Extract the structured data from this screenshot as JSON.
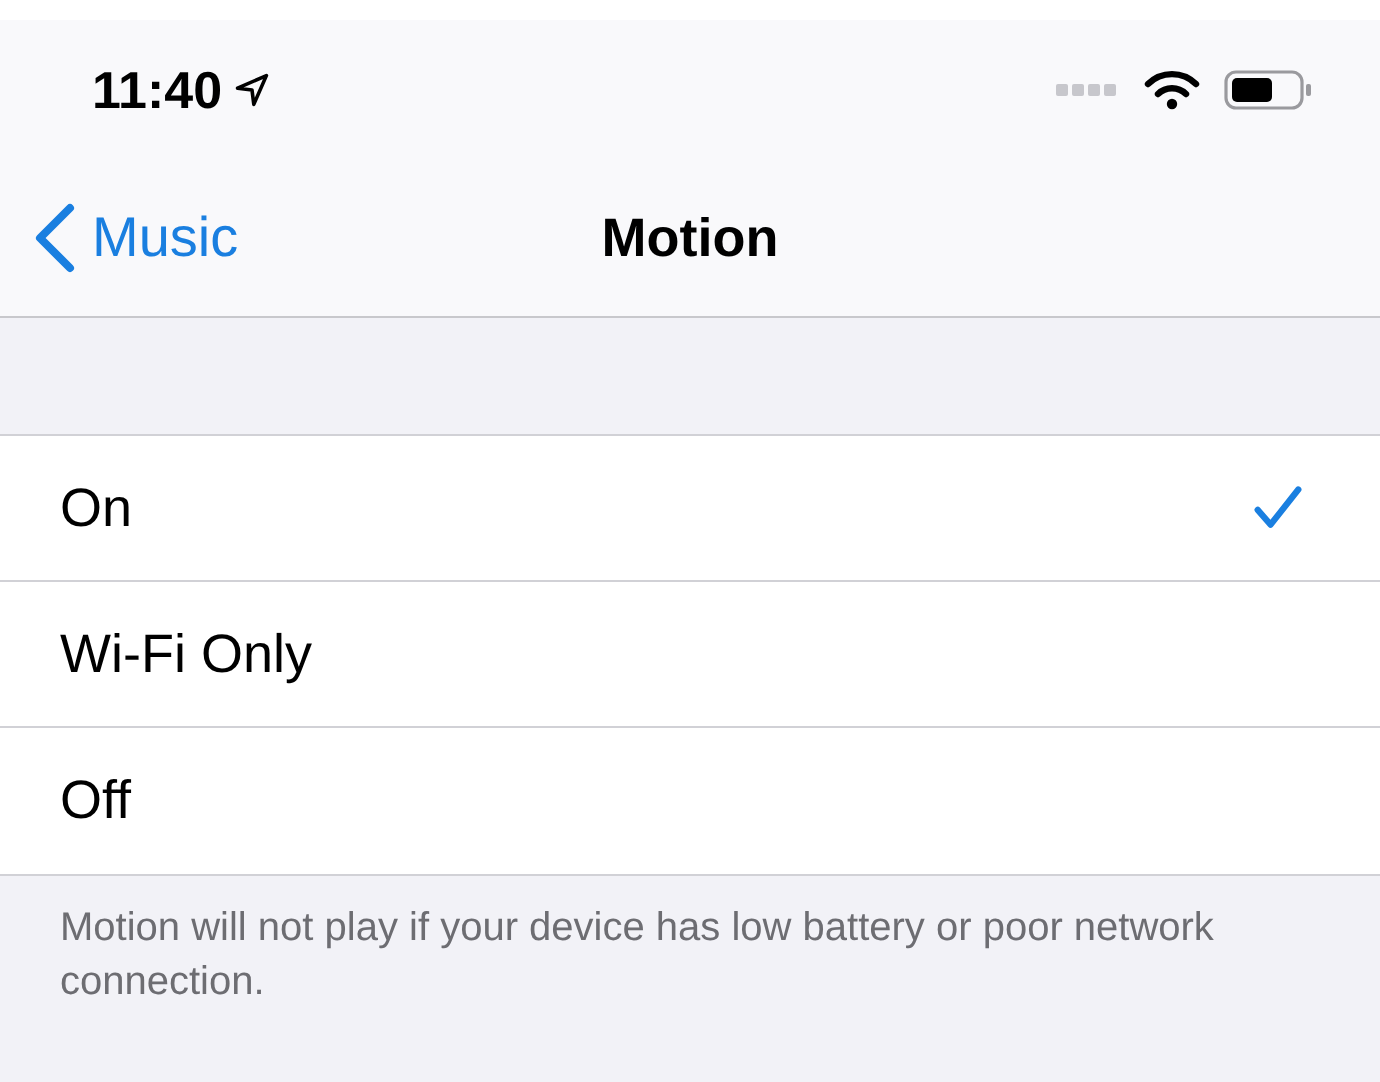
{
  "status_bar": {
    "time": "11:40"
  },
  "nav": {
    "back": "Music",
    "title": "Motion"
  },
  "options": [
    {
      "label": "On",
      "selected": true
    },
    {
      "label": "Wi-Fi Only",
      "selected": false
    },
    {
      "label": "Off",
      "selected": false
    }
  ],
  "footer": "Motion will not play if your device has low battery or poor network connection."
}
